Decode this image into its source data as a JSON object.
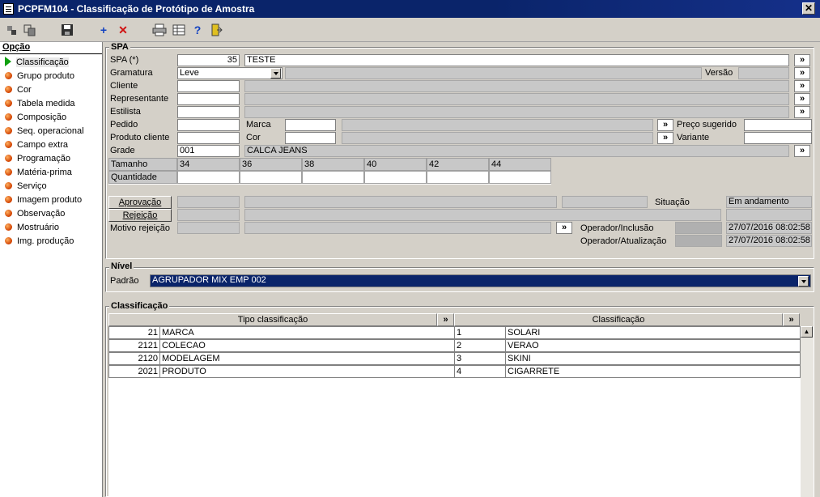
{
  "window": {
    "title": "PCPFM104 - Classificação de Protótipo de Amostra",
    "close": "✕"
  },
  "toolbar": {
    "add": "+",
    "remove": "✕",
    "help": "?"
  },
  "left": {
    "header": "Opção",
    "items": [
      "Classificação",
      "Grupo produto",
      "Cor",
      "Tabela medida",
      "Composição",
      "Seq. operacional",
      "Campo extra",
      "Programação",
      "Matéria-prima",
      "Serviço",
      "Imagem produto",
      "Observação",
      "Mostruário",
      "Img. produção"
    ]
  },
  "spa": {
    "title": "SPA",
    "labels": {
      "spa": "SPA (*)",
      "gramatura": "Gramatura",
      "cliente": "Cliente",
      "representante": "Representante",
      "estilista": "Estilista",
      "pedido": "Pedido",
      "produto_cliente": "Produto cliente",
      "grade": "Grade",
      "tamanho": "Tamanho",
      "quantidade": "Quantidade",
      "versao": "Versão",
      "marca": "Marca",
      "cor": "Cor",
      "preco": "Preço sugerido",
      "variante": "Variante",
      "motivo": "Motivo rejeição",
      "situacao": "Situação",
      "op_inclusao": "Operador/Inclusão",
      "op_atualizacao": "Operador/Atualização"
    },
    "values": {
      "spa": "35",
      "spa_desc": "TESTE",
      "gramatura": "Leve",
      "grade": "001",
      "grade_desc": "CALCA JEANS",
      "situacao": "Em andamento",
      "dt_inclusao": "27/07/2016 08:02:58",
      "dt_atualizacao": "27/07/2016 08:02:58"
    },
    "sizes": [
      "34",
      "36",
      "38",
      "40",
      "42",
      "44"
    ],
    "buttons": {
      "aprovacao": "Aprovação",
      "rejeicao": "Rejeição",
      "more": "»"
    }
  },
  "nivel": {
    "title": "Nível",
    "label": "Padrão",
    "value": "AGRUPADOR MIX EMP 002"
  },
  "classif": {
    "title": "Classificação",
    "columns": [
      "Tipo classificação",
      "Classificação"
    ],
    "rows": [
      {
        "code": "21",
        "tipo": "MARCA",
        "num": "1",
        "cls": "SOLARI"
      },
      {
        "code": "2121",
        "tipo": "COLECAO",
        "num": "2",
        "cls": "VERAO"
      },
      {
        "code": "2120",
        "tipo": "MODELAGEM",
        "num": "3",
        "cls": "SKINI"
      },
      {
        "code": "2021",
        "tipo": "PRODUTO",
        "num": "4",
        "cls": "CIGARRETE"
      }
    ]
  }
}
